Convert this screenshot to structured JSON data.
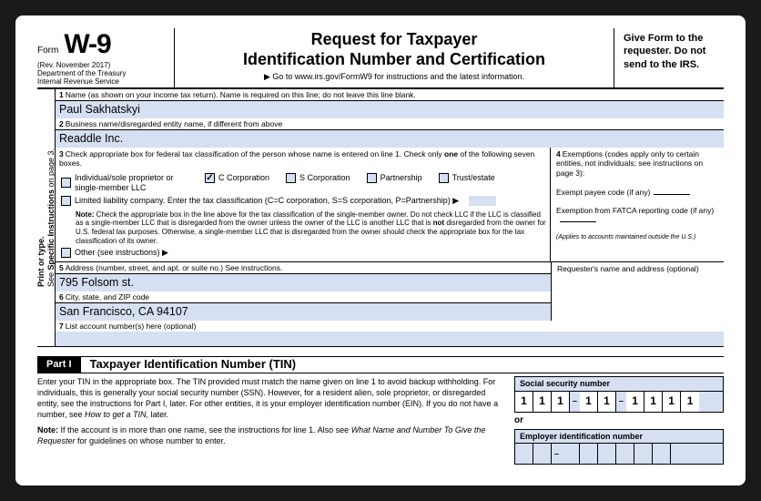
{
  "header": {
    "form_label": "Form",
    "form_code": "W-9",
    "rev": "(Rev. November 2017)",
    "dept": "Department of the Treasury",
    "irs": "Internal Revenue Service",
    "title_l1": "Request for Taxpayer",
    "title_l2": "Identification Number and Certification",
    "goto": "▶ Go to www.irs.gov/FormW9 for instructions and the latest information.",
    "right": "Give Form to the requester. Do not send to the IRS."
  },
  "side": "Print or type. See Specific Instructions on page 3.",
  "line1": {
    "num": "1",
    "lbl": "Name (as shown on your income tax return). Name is required on this line; do not leave this line blank.",
    "val": "Paul Sakhatskyi"
  },
  "line2": {
    "num": "2",
    "lbl": "Business name/disregarded entity name, if different from above",
    "val": "Readdle Inc."
  },
  "line3": {
    "num": "3",
    "lbl": "Check appropriate box for federal tax classification of the person whose name is entered on line 1. Check only one of the following seven boxes.",
    "opts": {
      "indiv": "Individual/sole proprietor or single-member LLC",
      "ccorp": "C Corporation",
      "scorp": "S Corporation",
      "partner": "Partnership",
      "trust": "Trust/estate"
    },
    "checked": "ccorp",
    "llc": "Limited liability company. Enter the tax classification (C=C corporation, S=S corporation, P=Partnership) ▶",
    "note": "Note: Check the appropriate box in the line above for the tax classification of the single-member owner.  Do not check LLC if the LLC is classified as a single-member LLC that is disregarded from the owner unless the owner of the LLC is another LLC that is not disregarded from the owner for U.S. federal tax purposes. Otherwise, a single-member LLC that is disregarded from the owner should check the appropriate box for the tax classification of its owner.",
    "other": "Other (see instructions) ▶"
  },
  "line4": {
    "num": "4",
    "lbl": "Exemptions (codes apply only to certain entities, not individuals; see instructions on page 3):",
    "payee": "Exempt payee code (if any)",
    "fatca": "Exemption from FATCA reporting code (if any)",
    "tiny": "(Applies to accounts maintained outside the U.S.)"
  },
  "line5": {
    "num": "5",
    "lbl": "Address (number, street, and apt. or suite no.) See instructions.",
    "val": "795 Folsom st."
  },
  "line6": {
    "num": "6",
    "lbl": "City, state, and ZIP code",
    "val": "San Francisco, CA 94107"
  },
  "line7": {
    "num": "7",
    "lbl": "List account number(s) here (optional)"
  },
  "req": "Requester's name and address (optional)",
  "part1": {
    "tag": "Part I",
    "title": "Taxpayer Identification Number (TIN)",
    "p1": "Enter your TIN in the appropriate box. The TIN provided must match the name given on line 1 to avoid backup withholding. For individuals, this is generally your social security number (SSN). However, for a resident alien, sole proprietor, or disregarded entity, see the instructions for Part I, later. For other entities, it is your employer identification number (EIN). If you do not have a number, see How to get a TIN, later.",
    "p2": "Note: If the account is in more than one name, see the instructions for line 1. Also see What Name and Number To Give the Requester for guidelines on whose number to enter.",
    "ssn_lbl": "Social security number",
    "ssn": [
      "1",
      "1",
      "1",
      "1",
      "1",
      "1",
      "1",
      "1",
      "1"
    ],
    "or": "or",
    "ein_lbl": "Employer identification number"
  }
}
